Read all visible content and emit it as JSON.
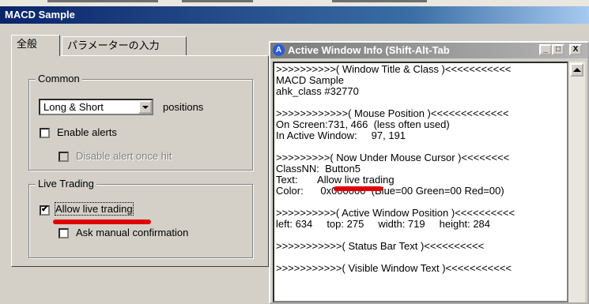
{
  "dialog": {
    "title": "MACD Sample",
    "tabs": [
      "全般",
      "パラメーターの入力"
    ],
    "common": {
      "label": "Common",
      "positions_value": "Long & Short",
      "positions_label": "positions",
      "enable_alerts": "Enable alerts",
      "disable_alert": "Disable alert once hit"
    },
    "live": {
      "label": "Live Trading",
      "allow_live": "Allow live trading",
      "ask_manual": "Ask manual confirmation"
    }
  },
  "awi": {
    "title": "Active Window Info (Shift-Alt-Tab",
    "buttons": [
      "_",
      "□",
      "X"
    ],
    "lines": [
      ">>>>>>>>>>( Window Title & Class )<<<<<<<<<<<",
      "MACD Sample",
      "ahk_class #32770",
      "",
      ">>>>>>>>>>>>( Mouse Position )<<<<<<<<<<<<<",
      "On Screen:731, 466  (less often used)",
      "In Active Window:     97, 191",
      "",
      ">>>>>>>>>( Now Under Mouse Cursor )<<<<<<<<",
      "ClassNN:  Button5",
      "Text:       Allow live trading",
      "Color:      0x000000  (Blue=00 Green=00 Red=00)",
      "",
      ">>>>>>>>>>( Active Window Position )<<<<<<<<<<",
      "left: 634     top: 275     width: 719     height: 284",
      "",
      ">>>>>>>>>>>( Status Bar Text )<<<<<<<<<<",
      "",
      ">>>>>>>>>>>( Visible Window Text )<<<<<<<<<<<"
    ]
  },
  "colors": {
    "highlight": "#e00000"
  }
}
